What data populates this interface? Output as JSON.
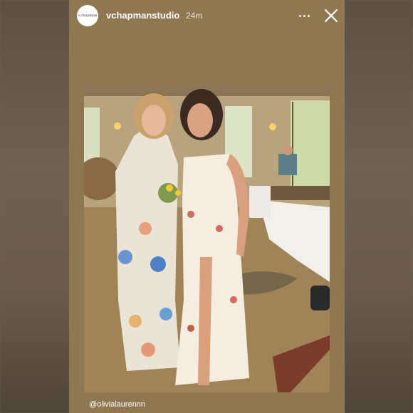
{
  "story": {
    "avatar_text": "v.chapman",
    "username": "vchapmanstudio",
    "timestamp": "24m",
    "mention": "@olivialaurennn"
  },
  "icons": {
    "more": "more-horizontal-icon",
    "close": "close-icon"
  },
  "colors": {
    "story_background": "#8f7752",
    "text": "#ffffff"
  }
}
